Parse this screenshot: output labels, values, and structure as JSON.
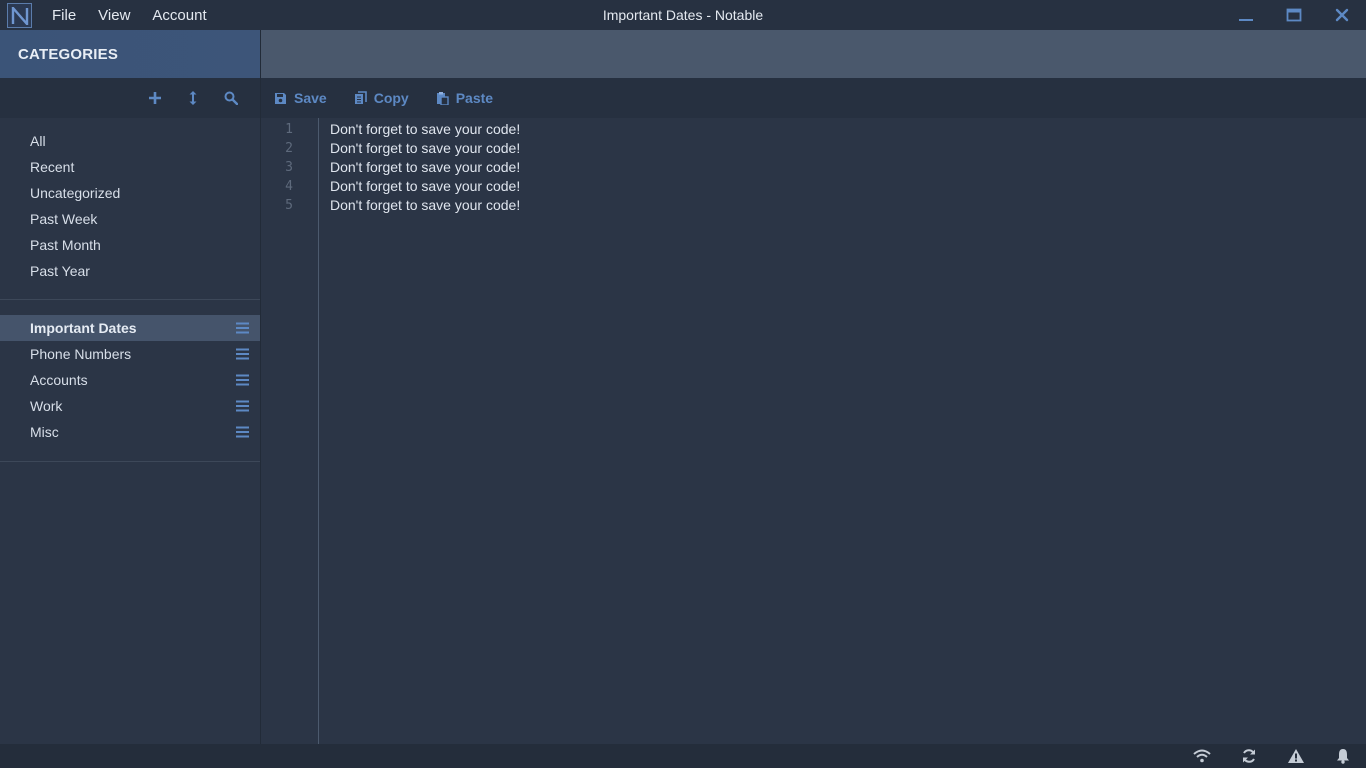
{
  "app": {
    "logo_letter": "N",
    "window_title": "Important Dates - Notable",
    "menu": [
      "File",
      "View",
      "Account"
    ]
  },
  "window_controls": [
    "minimize-icon",
    "maximize-icon",
    "close-icon"
  ],
  "sidebar": {
    "header": "CATEGORIES",
    "tools": [
      "plus-icon",
      "sort-icon",
      "search-icon"
    ],
    "categories": [
      "All",
      "Recent",
      "Uncategorized",
      "Past Week",
      "Past Month",
      "Past Year"
    ],
    "notes": [
      {
        "label": "Important Dates",
        "active": true
      },
      {
        "label": "Phone Numbers",
        "active": false
      },
      {
        "label": "Accounts",
        "active": false
      },
      {
        "label": "Work",
        "active": false
      },
      {
        "label": "Misc",
        "active": false
      }
    ]
  },
  "toolbar": {
    "save_label": "Save",
    "copy_label": "Copy",
    "paste_label": "Paste"
  },
  "editor": {
    "line_numbers": [
      "1",
      "2",
      "3",
      "4",
      "5"
    ],
    "lines": [
      "Don't forget to save your code!",
      "Don't forget to save your code!",
      "Don't forget to save your code!",
      "Don't forget to save your code!",
      "Don't forget to save your code!"
    ]
  },
  "status_icons": [
    "wifi-icon",
    "sync-icon",
    "warning-icon",
    "bell-icon"
  ],
  "colors": {
    "accent": "#5d89c4",
    "background": "#2b3546",
    "header": "#3b5478"
  }
}
